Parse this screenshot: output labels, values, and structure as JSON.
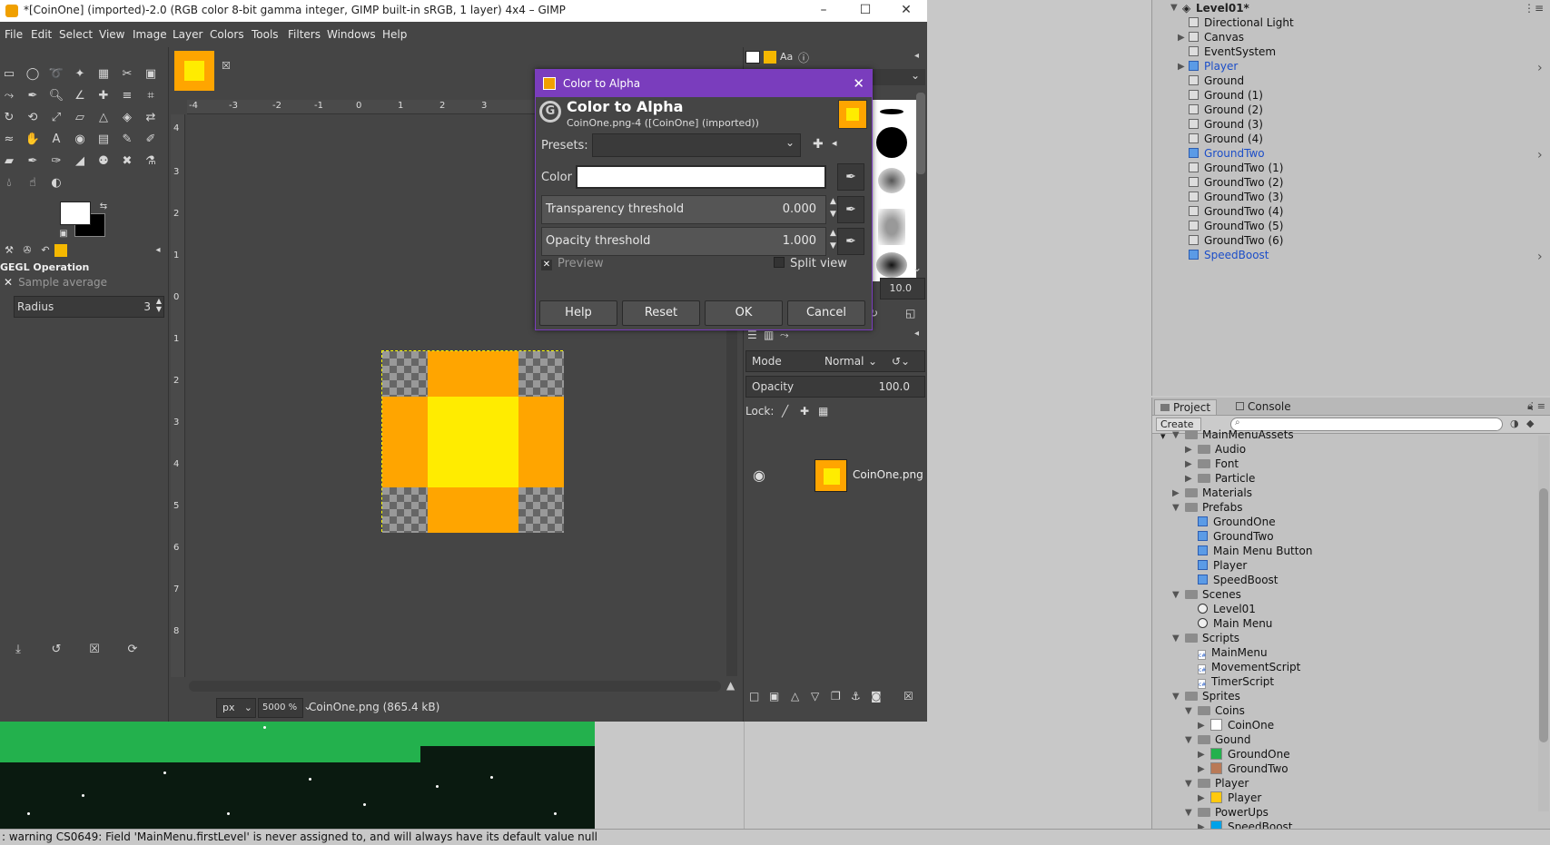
{
  "gimp": {
    "title": "*[CoinOne] (imported)-2.0 (RGB color 8-bit gamma integer, GIMP built-in sRGB, 1 layer) 4x4 – GIMP",
    "menu": [
      "File",
      "Edit",
      "Select",
      "View",
      "Image",
      "Layer",
      "Colors",
      "Tools",
      "Filters",
      "Windows",
      "Help"
    ],
    "tool_options": {
      "title": "GEGL Operation",
      "sample_average": "Sample average",
      "radius_label": "Radius",
      "radius_value": "3"
    },
    "ruler_top": [
      "-4",
      "-3",
      "-2",
      "-1",
      "0",
      "1",
      "2",
      "3"
    ],
    "ruler_left": [
      "4",
      "3",
      "2",
      "1",
      "0",
      "1",
      "2",
      "3",
      "4",
      "5",
      "6",
      "7",
      "8"
    ],
    "status": {
      "unit": "px",
      "zoom": "5000 %",
      "file": "CoinOne.png (865.4 kB)"
    },
    "brush_value": "10.0",
    "layers": {
      "mode_label": "Mode",
      "mode_value": "Normal",
      "opacity_label": "Opacity",
      "opacity_value": "100.0",
      "lock_label": "Lock:",
      "layer_name": "CoinOne.png"
    }
  },
  "dialog": {
    "title": "Color to Alpha",
    "heading": "Color to Alpha",
    "subheading": "CoinOne.png-4 ([CoinOne] (imported))",
    "presets_label": "Presets:",
    "color_label": "Color",
    "transparency_label": "Transparency threshold",
    "transparency_value": "0.000",
    "opacity_label": "Opacity threshold",
    "opacity_value": "1.000",
    "preview_label": "Preview",
    "split_view_label": "Split view",
    "buttons": {
      "help": "Help",
      "reset": "Reset",
      "ok": "OK",
      "cancel": "Cancel"
    }
  },
  "hierarchy": {
    "root": "Level01*",
    "items": [
      {
        "label": "Directional Light",
        "prefab": false,
        "expand": false
      },
      {
        "label": "Canvas",
        "prefab": false,
        "expand": true
      },
      {
        "label": "EventSystem",
        "prefab": false,
        "expand": false
      },
      {
        "label": "Player",
        "prefab": true,
        "expand": true
      },
      {
        "label": "Ground",
        "prefab": false,
        "expand": false
      },
      {
        "label": "Ground (1)",
        "prefab": false,
        "expand": false
      },
      {
        "label": "Ground (2)",
        "prefab": false,
        "expand": false
      },
      {
        "label": "Ground (3)",
        "prefab": false,
        "expand": false
      },
      {
        "label": "Ground (4)",
        "prefab": false,
        "expand": false
      },
      {
        "label": "GroundTwo",
        "prefab": true,
        "expand": false
      },
      {
        "label": "GroundTwo (1)",
        "prefab": false,
        "expand": false
      },
      {
        "label": "GroundTwo (2)",
        "prefab": false,
        "expand": false
      },
      {
        "label": "GroundTwo (3)",
        "prefab": false,
        "expand": false
      },
      {
        "label": "GroundTwo (4)",
        "prefab": false,
        "expand": false
      },
      {
        "label": "GroundTwo (5)",
        "prefab": false,
        "expand": false
      },
      {
        "label": "GroundTwo (6)",
        "prefab": false,
        "expand": false
      },
      {
        "label": "SpeedBoost",
        "prefab": true,
        "expand": false
      }
    ]
  },
  "project": {
    "tabs": [
      "Project",
      "Console"
    ],
    "create_label": "Create",
    "items": [
      {
        "label": "MainMenuAssets",
        "type": "folder",
        "depth": 1,
        "tri": "open"
      },
      {
        "label": "Audio",
        "type": "folder",
        "depth": 2,
        "tri": "closed"
      },
      {
        "label": "Font",
        "type": "folder",
        "depth": 2,
        "tri": "closed"
      },
      {
        "label": "Particle",
        "type": "folder",
        "depth": 2,
        "tri": "closed"
      },
      {
        "label": "Materials",
        "type": "folder",
        "depth": 1,
        "tri": "closed"
      },
      {
        "label": "Prefabs",
        "type": "folder",
        "depth": 1,
        "tri": "open"
      },
      {
        "label": "GroundOne",
        "type": "prefab",
        "depth": 2,
        "tri": ""
      },
      {
        "label": "GroundTwo",
        "type": "prefab",
        "depth": 2,
        "tri": ""
      },
      {
        "label": "Main Menu Button",
        "type": "prefab",
        "depth": 2,
        "tri": ""
      },
      {
        "label": "Player",
        "type": "prefab",
        "depth": 2,
        "tri": ""
      },
      {
        "label": "SpeedBoost",
        "type": "prefab",
        "depth": 2,
        "tri": ""
      },
      {
        "label": "Scenes",
        "type": "folder",
        "depth": 1,
        "tri": "open"
      },
      {
        "label": "Level01",
        "type": "scene",
        "depth": 2,
        "tri": ""
      },
      {
        "label": "Main Menu",
        "type": "scene",
        "depth": 2,
        "tri": ""
      },
      {
        "label": "Scripts",
        "type": "folder",
        "depth": 1,
        "tri": "open"
      },
      {
        "label": "MainMenu",
        "type": "script",
        "depth": 2,
        "tri": ""
      },
      {
        "label": "MovementScript",
        "type": "script",
        "depth": 2,
        "tri": ""
      },
      {
        "label": "TimerScript",
        "type": "script",
        "depth": 2,
        "tri": ""
      },
      {
        "label": "Sprites",
        "type": "folder",
        "depth": 1,
        "tri": "open"
      },
      {
        "label": "Coins",
        "type": "folder",
        "depth": 2,
        "tri": "open"
      },
      {
        "label": "CoinOne",
        "type": "sprite",
        "depth": 3,
        "tri": "closed",
        "color": "#ffffff"
      },
      {
        "label": "Gound",
        "type": "folder",
        "depth": 2,
        "tri": "open"
      },
      {
        "label": "GroundOne",
        "type": "sprite",
        "depth": 3,
        "tri": "closed",
        "color": "#23b14d"
      },
      {
        "label": "GroundTwo",
        "type": "sprite",
        "depth": 3,
        "tri": "closed",
        "color": "#b97a57"
      },
      {
        "label": "Player",
        "type": "folder",
        "depth": 2,
        "tri": "open"
      },
      {
        "label": "Player",
        "type": "sprite",
        "depth": 3,
        "tri": "closed",
        "color": "#ffc90e"
      },
      {
        "label": "PowerUps",
        "type": "folder",
        "depth": 2,
        "tri": "open"
      },
      {
        "label": "SpeedBoost",
        "type": "sprite",
        "depth": 3,
        "tri": "closed",
        "color": "#00a2e8"
      }
    ]
  },
  "console": {
    "message": ": warning CS0649: Field 'MainMenu.firstLevel' is never assigned to, and will always have its default value null"
  },
  "colors": {
    "orange": "#ffa500",
    "yellow": "#ffec00",
    "dialog_accent": "#7a3dbd"
  }
}
